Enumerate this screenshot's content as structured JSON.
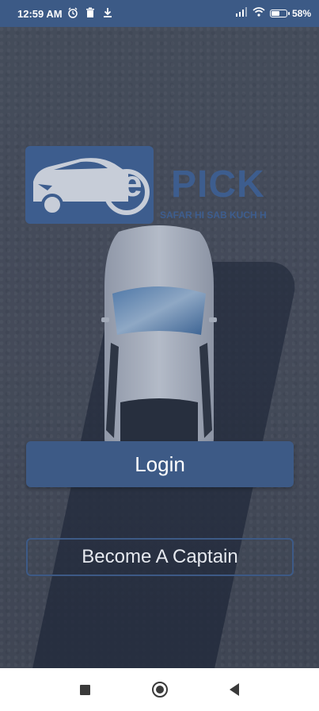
{
  "status_bar": {
    "time": "12:59 AM",
    "left_icons": [
      "alarm-icon",
      "trash-icon",
      "download-icon"
    ],
    "right_icons": [
      "signal-icon",
      "wifi-icon",
      "battery-icon"
    ],
    "battery_percent": "58%",
    "battery_level": 0.58
  },
  "logo": {
    "wordmark": "PICK",
    "letter": "e",
    "tagline": "SAFAR HI SAB KUCH H"
  },
  "actions": {
    "login_label": "Login",
    "captain_label": "Become A Captain"
  },
  "nav_bar": {
    "buttons": [
      "recents-icon",
      "home-icon",
      "back-icon"
    ]
  },
  "colors": {
    "brand_blue": "#3d5a86",
    "status_bar_bg": "#3c5a86",
    "nav_bar_bg": "#ffffff"
  }
}
